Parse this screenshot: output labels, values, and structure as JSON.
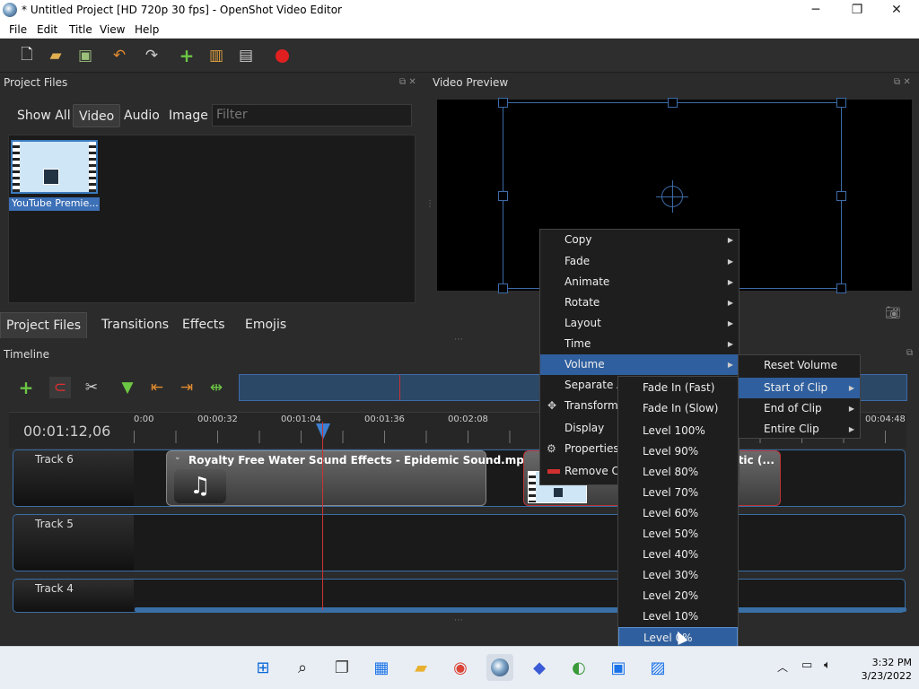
{
  "window": {
    "title": "* Untitled Project [HD 720p 30 fps] - OpenShot Video Editor",
    "minimize": "─",
    "maximize": "❐",
    "close": "✕"
  },
  "menubar": {
    "file": "File",
    "edit": "Edit",
    "title": "Title",
    "view": "View",
    "help": "Help"
  },
  "project_files": {
    "header": "Project Files",
    "filters": [
      "Show All",
      "Video",
      "Audio",
      "Image"
    ],
    "active_filter": "Video",
    "filter_placeholder": "Filter",
    "file_label": "YouTube Premie..."
  },
  "bottom_tabs": [
    "Project Files",
    "Transitions",
    "Effects",
    "Emojis"
  ],
  "video_preview": {
    "header": "Video Preview"
  },
  "timeline": {
    "header": "Timeline",
    "timecode": "00:01:12,06",
    "ruler_ticks": [
      "0:00",
      "00:00:32",
      "00:01:04",
      "00:01:36",
      "00:02:08",
      "00:04:48"
    ],
    "tracks": [
      {
        "name": "Track 6"
      },
      {
        "name": "Track 5"
      },
      {
        "name": "Track 4"
      }
    ],
    "clip_audio": "Royalty Free Water Sound Effects - Epidemic Sound.mp3",
    "clip_video_suffix": "atic (..."
  },
  "context_menu": {
    "items": [
      "Copy",
      "Fade",
      "Animate",
      "Rotate",
      "Layout",
      "Time",
      "Volume",
      "Separate Au",
      "Transform",
      "Display",
      "Properties",
      "Remove Cli"
    ],
    "highlighted": "Volume"
  },
  "volume_submenu": {
    "items": [
      "Reset Volume",
      "Start of Clip",
      "End of Clip",
      "Entire Clip"
    ],
    "highlighted": "Start of Clip"
  },
  "start_submenu": {
    "items": [
      "Fade In (Fast)",
      "Fade In (Slow)",
      "Level 100%",
      "Level 90%",
      "Level 80%",
      "Level 70%",
      "Level 60%",
      "Level 50%",
      "Level 40%",
      "Level 30%",
      "Level 20%",
      "Level 10%",
      "Level 0%"
    ],
    "highlighted": "Level 0%"
  },
  "taskbar": {
    "time": "3:32 PM",
    "date": "3/23/2022"
  },
  "colors": {
    "accent": "#2f5f9e",
    "track_border": "#3a6fa6",
    "playhead": "#cc3333"
  }
}
